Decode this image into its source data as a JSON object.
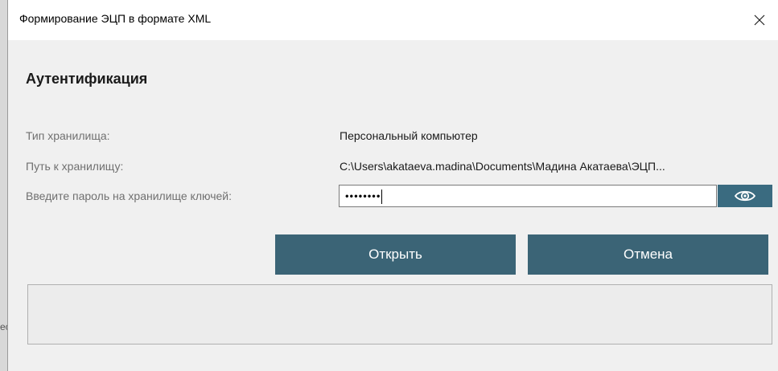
{
  "window": {
    "title": "Формирование ЭЦП в формате XML",
    "close_glyph": "✕"
  },
  "section": {
    "title": "Аутентификация"
  },
  "fields": {
    "storage_type_label": "Тип хранилища:",
    "storage_type_value": "Персональный компьютер",
    "storage_path_label": "Путь к хранилищу:",
    "storage_path_value": "C:\\Users\\akataeva.madina\\Documents\\Мадина Акатаева\\ЭЦП...",
    "password_label": "Введите пароль на хранилище ключей:",
    "password_value": "••••••••"
  },
  "buttons": {
    "open_label": "Открыть",
    "cancel_label": "Отмена",
    "show_password_icon": "eye-icon"
  },
  "colors": {
    "button_bg": "#3b6476",
    "eye_button_bg": "#3a6b80",
    "label_gray": "#707070"
  }
}
